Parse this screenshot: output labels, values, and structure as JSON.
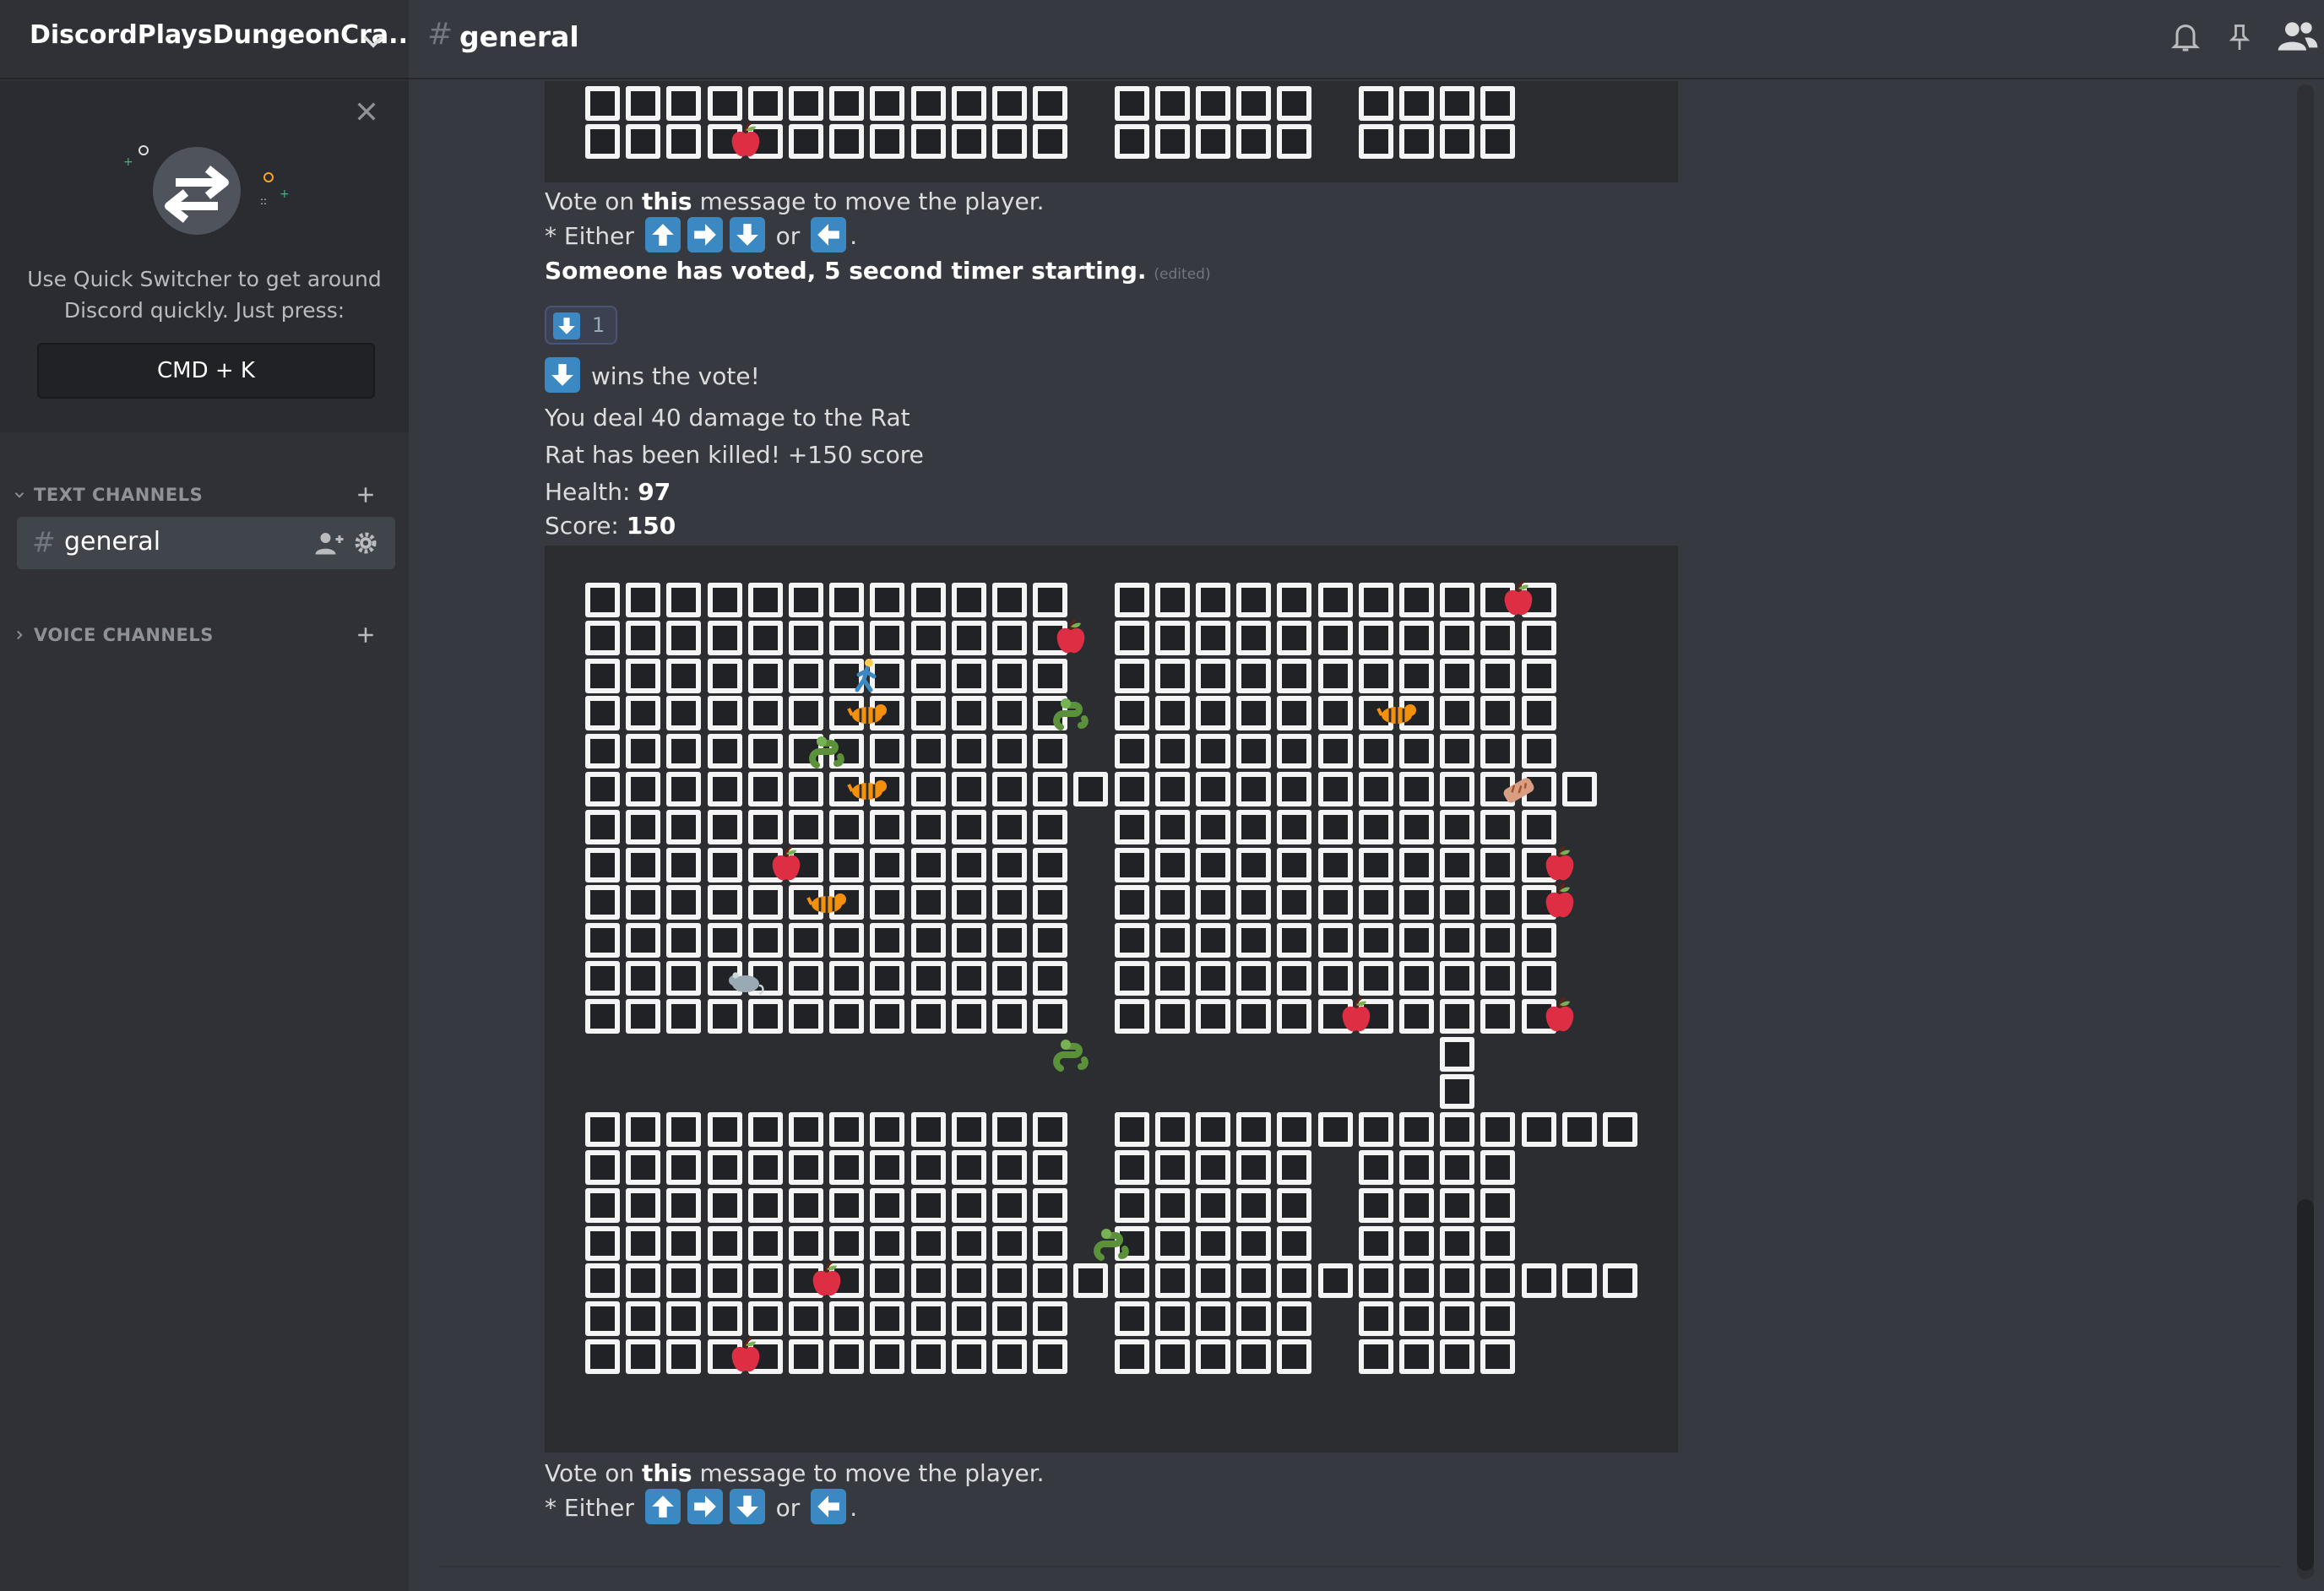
{
  "server": {
    "name": "DiscordPlaysDungeonCra...",
    "chevron_icon": "chevron-down-icon"
  },
  "quick_switcher": {
    "text_line1": "Use Quick Switcher to get around",
    "text_line2": "Discord quickly. Just press:",
    "shortcut": "CMD + K"
  },
  "sidebar": {
    "text_channels_label": "TEXT CHANNELS",
    "voice_channels_label": "VOICE CHANNELS",
    "channels": [
      {
        "name": "general",
        "icon": "hash-icon"
      }
    ]
  },
  "header": {
    "channel_name": "general",
    "icons": [
      "bell-icon",
      "pin-icon",
      "members-icon"
    ]
  },
  "messages": {
    "vote_prompt_pre": "Vote on ",
    "vote_prompt_bold": "this",
    "vote_prompt_post": " message to move the player.",
    "either_label": "* Either",
    "or_label": "or",
    "period": ".",
    "timer_text": "Someone has voted, 5 second timer starting.",
    "edited_label": "(edited)",
    "reaction": {
      "emoji": "arrow-down-icon",
      "count": "1"
    },
    "wins_text": "wins the vote!",
    "damage_text": "You deal 40 damage to the Rat",
    "killed_text": "Rat has been killed! +150 score",
    "health_label": "Health:",
    "health_value": "97",
    "score_label": "Score:",
    "score_value": "150"
  },
  "game_map": {
    "cols": 26,
    "rows": 22,
    "floor_rows": [
      "##.###########.##########",
      "##.###########..#########",
      "##.###########...########"
    ],
    "walls": [
      "..........................",
      ".############.###########.",
      ".############.###########.",
      ".############.###########.",
      ".############.###########.",
      ".############.###########.",
      ".#########################",
      ".############.###########.",
      ".############.###########.",
      ".############.###########.",
      ".############.###########.",
      ".############.###########.",
      ".############.###########.",
      "......................#...",
      "......................#...",
      ".############.#################",
      ".############.#####.####.",
      ".############.#####.####.",
      ".############.#####.####.",
      ".##########################",
      ".############.#####.####.",
      ".############.#####.####."
    ],
    "entities": [
      {
        "type": "apple",
        "row": 0,
        "col": 4
      },
      {
        "type": "apple",
        "row": 1,
        "col": 23
      },
      {
        "type": "apple",
        "row": 2,
        "col": 12
      },
      {
        "type": "person",
        "row": 3,
        "col": 7
      },
      {
        "type": "tiger",
        "row": 4,
        "col": 7
      },
      {
        "type": "snake",
        "row": 4,
        "col": 12
      },
      {
        "type": "tiger",
        "row": 4,
        "col": 20
      },
      {
        "type": "snake",
        "row": 5,
        "col": 6
      },
      {
        "type": "tiger",
        "row": 6,
        "col": 7
      },
      {
        "type": "bread",
        "row": 6,
        "col": 23
      },
      {
        "type": "apple",
        "row": 8,
        "col": 5
      },
      {
        "type": "apple",
        "row": 8,
        "col": 24
      },
      {
        "type": "tiger",
        "row": 9,
        "col": 6
      },
      {
        "type": "apple",
        "row": 9,
        "col": 24
      },
      {
        "type": "rat",
        "row": 11,
        "col": 4
      },
      {
        "type": "apple",
        "row": 12,
        "col": 19
      },
      {
        "type": "apple",
        "row": 12,
        "col": 24
      },
      {
        "type": "snake",
        "row": 13,
        "col": 12
      },
      {
        "type": "snake",
        "row": 18,
        "col": 13
      },
      {
        "type": "apple",
        "row": 19,
        "col": 6
      },
      {
        "type": "apple",
        "row": 21,
        "col": 4
      }
    ]
  },
  "colors": {
    "background": "#36393f",
    "sidebar": "#2f3136",
    "arrow_key": "#3b88c3",
    "wall": "#f4f4f4",
    "floor": "#202225"
  }
}
